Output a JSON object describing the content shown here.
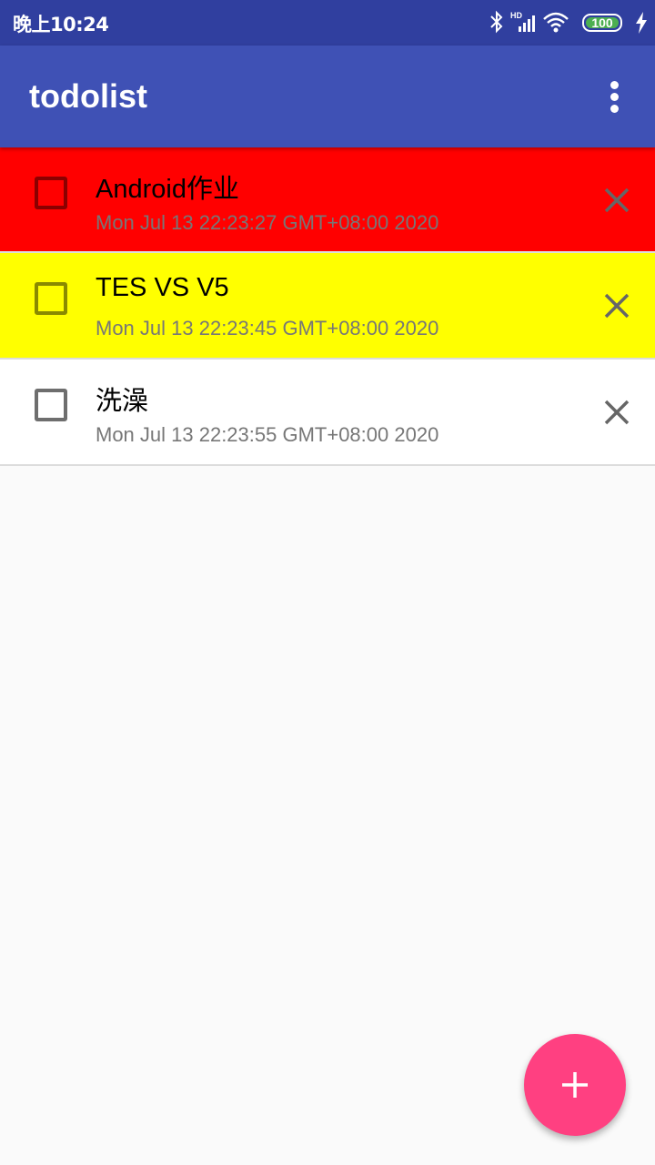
{
  "status_bar": {
    "time": "晚上10:24",
    "battery_level": "100",
    "network_label": "HD",
    "icons": [
      "bluetooth-icon",
      "signal-icon",
      "wifi-icon",
      "battery-icon",
      "charging-icon"
    ]
  },
  "app_bar": {
    "title": "todolist",
    "menu_icon": "overflow-menu-icon"
  },
  "todos": [
    {
      "title": "Android作业",
      "date": "Mon Jul 13 22:23:27 GMT+08:00 2020",
      "checked": false,
      "background": "#ff0000",
      "checkbox_color": "#8b0000"
    },
    {
      "title": "TES VS V5",
      "date": "Mon Jul 13 22:23:45 GMT+08:00 2020",
      "checked": false,
      "background": "#ffff00",
      "checkbox_color": "#8a8a00"
    },
    {
      "title": "洗澡",
      "date": "Mon Jul 13 22:23:55 GMT+08:00 2020",
      "checked": false,
      "background": "#ffffff",
      "checkbox_color": "#6e6e6e"
    }
  ],
  "fab": {
    "icon": "plus-icon",
    "color": "#ff4081"
  },
  "colors": {
    "status_bar": "#303f9f",
    "app_bar": "#3f51b5",
    "background": "#fafafa"
  }
}
